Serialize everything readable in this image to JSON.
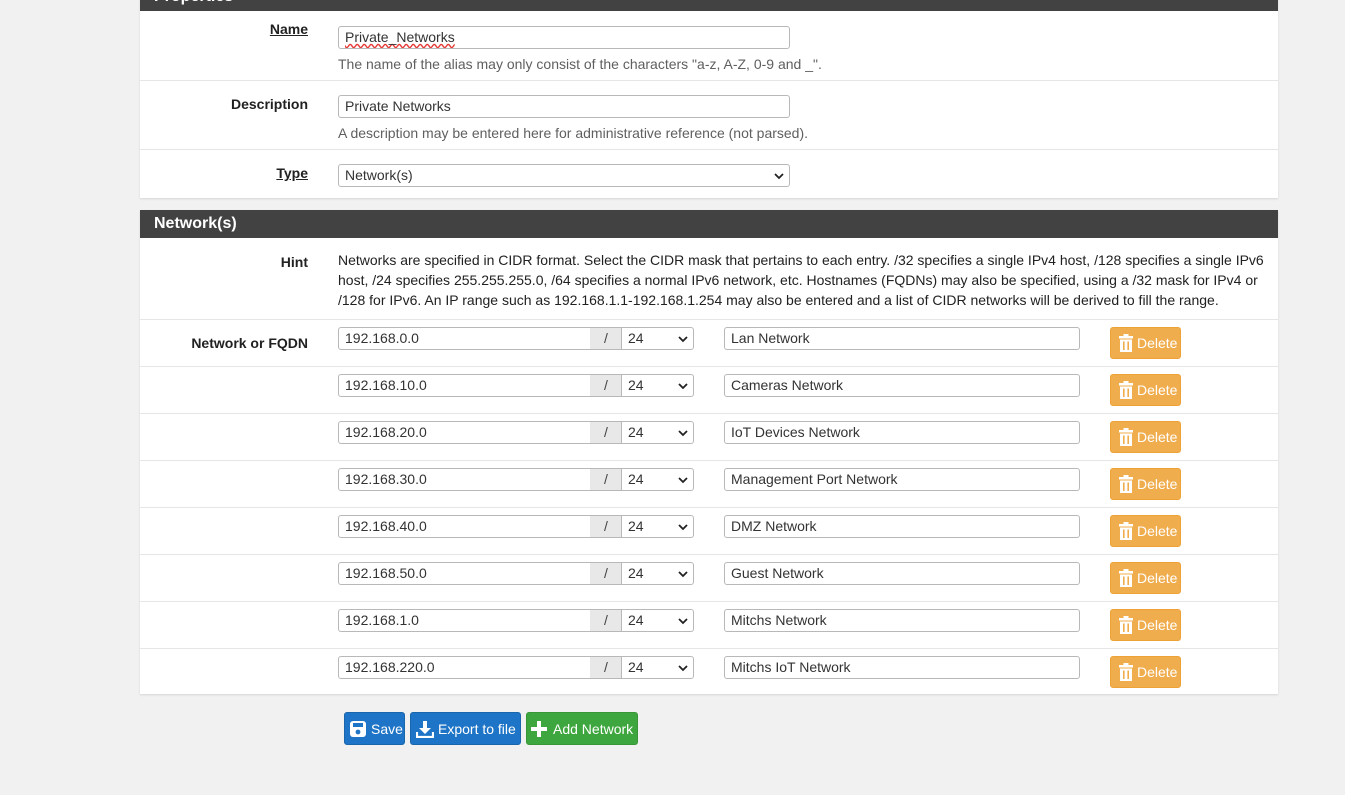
{
  "properties": {
    "heading": "Properties",
    "name": {
      "label": "Name",
      "value": "Private_Networks",
      "help": "The name of the alias may only consist of the characters \"a-z, A-Z, 0-9 and _\"."
    },
    "description": {
      "label": "Description",
      "value": "Private Networks",
      "help": "A description may be entered here for administrative reference (not parsed)."
    },
    "type": {
      "label": "Type",
      "value": "Network(s)"
    }
  },
  "networks": {
    "heading": "Network(s)",
    "hint_label": "Hint",
    "hint_text": "Networks are specified in CIDR format. Select the CIDR mask that pertains to each entry. /32 specifies a single IPv4 host, /128 specifies a single IPv6 host, /24 specifies 255.255.255.0, /64 specifies a normal IPv6 network, etc. Hostnames (FQDNs) may also be specified, using a /32 mask for IPv4 or /128 for IPv6. An IP range such as 192.168.1.1-192.168.1.254 may also be entered and a list of CIDR networks will be derived to fill the range.",
    "row_label": "Network or FQDN",
    "slash": "/",
    "delete_label": "Delete",
    "entries": [
      {
        "address": "192.168.0.0",
        "mask": "24",
        "description": "Lan Network"
      },
      {
        "address": "192.168.10.0",
        "mask": "24",
        "description": "Cameras Network"
      },
      {
        "address": "192.168.20.0",
        "mask": "24",
        "description": "IoT Devices Network"
      },
      {
        "address": "192.168.30.0",
        "mask": "24",
        "description": "Management Port Network"
      },
      {
        "address": "192.168.40.0",
        "mask": "24",
        "description": "DMZ Network"
      },
      {
        "address": "192.168.50.0",
        "mask": "24",
        "description": "Guest Network"
      },
      {
        "address": "192.168.1.0",
        "mask": "24",
        "description": "Mitchs Network"
      },
      {
        "address": "192.168.220.0",
        "mask": "24",
        "description": "Mitchs IoT Network"
      }
    ]
  },
  "actions": {
    "save": "Save",
    "export": "Export to file",
    "add": "Add Network"
  },
  "colors": {
    "panel_heading": "#424242",
    "primary": "#1e74c6",
    "success": "#3ea63e",
    "warning": "#f0ad4e"
  },
  "icons": {
    "save": "floppy-disk-icon",
    "export": "download-icon",
    "add": "plus-icon",
    "delete": "trash-icon",
    "select": "chevron-down-icon"
  }
}
